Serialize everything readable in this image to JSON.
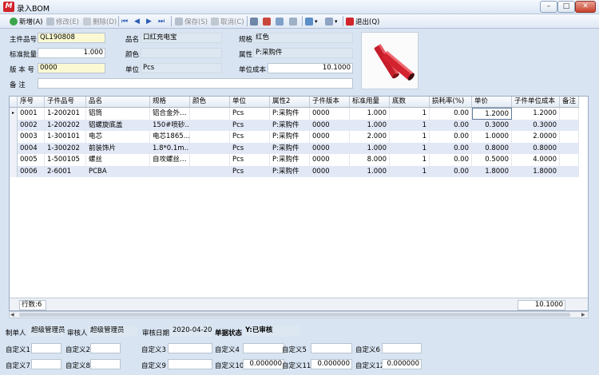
{
  "window": {
    "title": "录入BOM",
    "app_icon_letter": "M",
    "btn_minimize": "–",
    "btn_maximize": "□",
    "btn_close": "✕"
  },
  "toolbar": {
    "new": "新增(A)",
    "edit": "修改(E)",
    "delete": "删除(D)",
    "save": "保存(S)",
    "cancel": "取消(C)",
    "exit": "退出(Q)"
  },
  "form": {
    "main_part_label": "主件品号",
    "main_part": "QL190808",
    "name_label": "品名",
    "name": "口红充电宝",
    "spec_label": "规格",
    "spec": "红色",
    "std_batch_label": "标准批量",
    "std_batch": "1.000",
    "color_label": "颜色",
    "color": "",
    "attr_label": "属性",
    "attr": "P:采购件",
    "version_label": "版 本 号",
    "version": "0000",
    "unit_label": "单位",
    "unit": "Pcs",
    "unit_cost_label": "单位成本",
    "unit_cost": "10.1000",
    "remark_label": "备    注",
    "remark": ""
  },
  "grid": {
    "headers": [
      "序号",
      "子件品号",
      "品名",
      "规格",
      "颜色",
      "单位",
      "属性2",
      "子件版本",
      "标准用量",
      "底数",
      "损耗率(%)",
      "单价",
      "子件单位成本",
      "备注"
    ],
    "rows": [
      [
        "0001",
        "1-200201",
        "铝筒",
        "铝合金外…",
        "",
        "Pcs",
        "P:采购件",
        "0000",
        "1.000",
        "1",
        "0.00",
        "1.2000",
        "1.2000",
        ""
      ],
      [
        "0002",
        "1-200202",
        "铝螺旋底盖",
        "150#喷砂…",
        "",
        "Pcs",
        "P:采购件",
        "0000",
        "1.000",
        "1",
        "0.00",
        "0.3000",
        "0.3000",
        ""
      ],
      [
        "0003",
        "1-300101",
        "电芯",
        "电芯1865…",
        "",
        "Pcs",
        "P:采购件",
        "0000",
        "2.000",
        "1",
        "0.00",
        "1.0000",
        "2.0000",
        ""
      ],
      [
        "0004",
        "1-300202",
        "前装饰片",
        "1.8*0.1m…",
        "",
        "Pcs",
        "P:采购件",
        "0000",
        "1.000",
        "1",
        "0.00",
        "0.8000",
        "0.8000",
        ""
      ],
      [
        "0005",
        "1-500105",
        "螺丝",
        "自攻螺丝…",
        "",
        "Pcs",
        "P:采购件",
        "0000",
        "8.000",
        "1",
        "0.00",
        "0.5000",
        "4.0000",
        ""
      ],
      [
        "0006",
        "2-6001",
        "PCBA",
        "",
        "",
        "Pcs",
        "P:采购件",
        "0000",
        "1.000",
        "1",
        "0.00",
        "1.8000",
        "1.8000",
        ""
      ]
    ],
    "row_count": "行数:6",
    "total_cost": "10.1000"
  },
  "bottom": {
    "maker_label": "制单人",
    "maker": "超级管理员",
    "reviewer_label": "审核人",
    "reviewer": "超级管理员",
    "review_date_label": "审核日期",
    "review_date": "2020-04-20",
    "status_label": "单据状态",
    "status": "Y:已审核",
    "custom": [
      {
        "label": "自定义1",
        "value": ""
      },
      {
        "label": "自定义2",
        "value": ""
      },
      {
        "label": "自定义3",
        "value": ""
      },
      {
        "label": "自定义4",
        "value": ""
      },
      {
        "label": "自定义5",
        "value": ""
      },
      {
        "label": "自定义6",
        "value": ""
      },
      {
        "label": "自定义7",
        "value": ""
      },
      {
        "label": "自定义8",
        "value": ""
      },
      {
        "label": "自定义9",
        "value": ""
      },
      {
        "label": "自定义10",
        "value": "0.000000"
      },
      {
        "label": "自定义11",
        "value": "0.000000"
      },
      {
        "label": "自定义12",
        "value": "0.000000"
      }
    ]
  },
  "colors": {
    "accent_red": "#d2232a",
    "row_alt": "#e2e8f6",
    "readonly_field": "#dde7f1",
    "yellow_field": "#fbf9d3"
  }
}
